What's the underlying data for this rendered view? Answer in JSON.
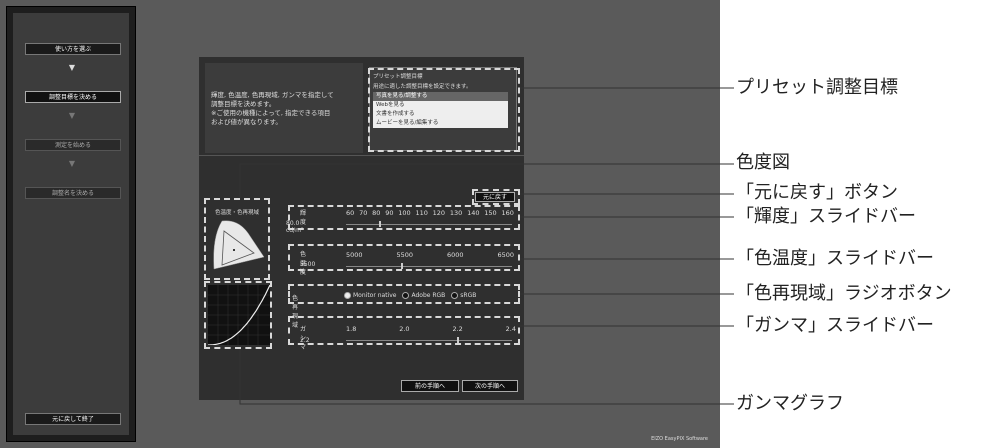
{
  "sidebar": {
    "steps": [
      {
        "label": "使い方を選ぶ",
        "state": "normal"
      },
      {
        "label": "調整目標を決める",
        "state": "active"
      },
      {
        "label": "測定を始める",
        "state": "dim"
      },
      {
        "label": "調整名を決める",
        "state": "dim"
      }
    ],
    "arrow": "▼",
    "exit_label": "元に戻して終了"
  },
  "description": {
    "line1": "輝度, 色温度, 色再現域, ガンマを指定して",
    "line2": "調整目標を決めます。",
    "line3": "※ご使用の機種によって, 指定できる項目",
    "line4": "および値が異なります。"
  },
  "preset": {
    "title": "プリセット調整目標",
    "subtitle": "用途に適した調整目標を設定できます。",
    "items": [
      {
        "label": "写真を見る/調整する",
        "selected": true
      },
      {
        "label": "Webを見る",
        "selected": false
      },
      {
        "label": "文書を作成する",
        "selected": false
      },
      {
        "label": "ムービーを見る/編集する",
        "selected": false
      }
    ]
  },
  "gamut_label": "色温度・色再現域",
  "reset_button": "元に戻す",
  "brightness": {
    "label": "輝度",
    "value": "80.0 cd/m²",
    "ticks": [
      "60",
      "70",
      "80",
      "90",
      "100",
      "110",
      "120",
      "130",
      "140",
      "150",
      "160"
    ],
    "level": 80
  },
  "color_temp": {
    "label": "色温度",
    "value": "5500 K",
    "ticks": [
      "5000",
      "5500",
      "6000",
      "6500"
    ],
    "level": 5500
  },
  "gamut": {
    "label": "色再現域",
    "options": [
      {
        "label": "Monitor native",
        "selected": true
      },
      {
        "label": "Adobe RGB",
        "selected": false
      },
      {
        "label": "sRGB",
        "selected": false
      }
    ]
  },
  "gamma": {
    "label": "ガンマ",
    "value": "2.2",
    "ticks": [
      "1.8",
      "2.0",
      "2.2",
      "2.4"
    ],
    "level": 2.2
  },
  "nav": {
    "prev": "前の手順へ",
    "next": "次の手順へ"
  },
  "brand": "EIZO EasyPIX Software",
  "callouts": {
    "preset": "プリセット調整目標",
    "chromaticity": "色度図",
    "reset": "「元に戻す」ボタン",
    "brightness": "「輝度」スライドバー",
    "color_temp": "「色温度」スライドバー",
    "gamut": "「色再現域」ラジオボタン",
    "gamma": "「ガンマ」スライドバー",
    "gamma_graph": "ガンマグラフ"
  }
}
